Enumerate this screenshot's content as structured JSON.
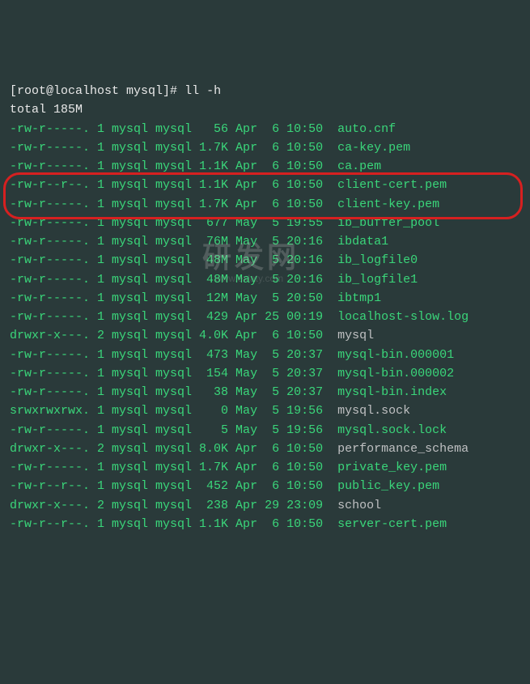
{
  "prompt": {
    "user_host": "root@localhost",
    "cwd": "mysql",
    "symbol": "#",
    "command": "ll -h"
  },
  "total_line": "total 185M",
  "rows": [
    {
      "perm": "-rw-r-----.",
      "n": "1",
      "owner": "mysql",
      "group": "mysql",
      "size": "56",
      "mon": "Apr",
      "day": "6",
      "time": "10:50",
      "name": "auto.cnf",
      "dir": false
    },
    {
      "perm": "-rw-r-----.",
      "n": "1",
      "owner": "mysql",
      "group": "mysql",
      "size": "1.7K",
      "mon": "Apr",
      "day": "6",
      "time": "10:50",
      "name": "ca-key.pem",
      "dir": false
    },
    {
      "perm": "-rw-r-----.",
      "n": "1",
      "owner": "mysql",
      "group": "mysql",
      "size": "1.1K",
      "mon": "Apr",
      "day": "6",
      "time": "10:50",
      "name": "ca.pem",
      "dir": false
    },
    {
      "perm": "-rw-r--r--.",
      "n": "1",
      "owner": "mysql",
      "group": "mysql",
      "size": "1.1K",
      "mon": "Apr",
      "day": "6",
      "time": "10:50",
      "name": "client-cert.pem",
      "dir": false
    },
    {
      "perm": "-rw-r-----.",
      "n": "1",
      "owner": "mysql",
      "group": "mysql",
      "size": "1.7K",
      "mon": "Apr",
      "day": "6",
      "time": "10:50",
      "name": "client-key.pem",
      "dir": false
    },
    {
      "perm": "-rw-r-----.",
      "n": "1",
      "owner": "mysql",
      "group": "mysql",
      "size": "677",
      "mon": "May",
      "day": "5",
      "time": "19:55",
      "name": "ib_buffer_pool",
      "dir": false
    },
    {
      "perm": "-rw-r-----.",
      "n": "1",
      "owner": "mysql",
      "group": "mysql",
      "size": "76M",
      "mon": "May",
      "day": "5",
      "time": "20:16",
      "name": "ibdata1",
      "dir": false
    },
    {
      "perm": "-rw-r-----.",
      "n": "1",
      "owner": "mysql",
      "group": "mysql",
      "size": "48M",
      "mon": "May",
      "day": "5",
      "time": "20:16",
      "name": "ib_logfile0",
      "dir": false
    },
    {
      "perm": "-rw-r-----.",
      "n": "1",
      "owner": "mysql",
      "group": "mysql",
      "size": "48M",
      "mon": "May",
      "day": "5",
      "time": "20:16",
      "name": "ib_logfile1",
      "dir": false
    },
    {
      "perm": "-rw-r-----.",
      "n": "1",
      "owner": "mysql",
      "group": "mysql",
      "size": "12M",
      "mon": "May",
      "day": "5",
      "time": "20:50",
      "name": "ibtmp1",
      "dir": false
    },
    {
      "perm": "-rw-r-----.",
      "n": "1",
      "owner": "mysql",
      "group": "mysql",
      "size": "429",
      "mon": "Apr",
      "day": "25",
      "time": "00:19",
      "name": "localhost-slow.log",
      "dir": false
    },
    {
      "perm": "drwxr-x---.",
      "n": "2",
      "owner": "mysql",
      "group": "mysql",
      "size": "4.0K",
      "mon": "Apr",
      "day": "6",
      "time": "10:50",
      "name": "mysql",
      "dir": true
    },
    {
      "perm": "-rw-r-----.",
      "n": "1",
      "owner": "mysql",
      "group": "mysql",
      "size": "473",
      "mon": "May",
      "day": "5",
      "time": "20:37",
      "name": "mysql-bin.000001",
      "dir": false
    },
    {
      "perm": "-rw-r-----.",
      "n": "1",
      "owner": "mysql",
      "group": "mysql",
      "size": "154",
      "mon": "May",
      "day": "5",
      "time": "20:37",
      "name": "mysql-bin.000002",
      "dir": false
    },
    {
      "perm": "-rw-r-----.",
      "n": "1",
      "owner": "mysql",
      "group": "mysql",
      "size": "38",
      "mon": "May",
      "day": "5",
      "time": "20:37",
      "name": "mysql-bin.index",
      "dir": false
    },
    {
      "perm": "srwxrwxrwx.",
      "n": "1",
      "owner": "mysql",
      "group": "mysql",
      "size": "0",
      "mon": "May",
      "day": "5",
      "time": "19:56",
      "name": "mysql.sock",
      "dir": true
    },
    {
      "perm": "-rw-r-----.",
      "n": "1",
      "owner": "mysql",
      "group": "mysql",
      "size": "5",
      "mon": "May",
      "day": "5",
      "time": "19:56",
      "name": "mysql.sock.lock",
      "dir": false
    },
    {
      "perm": "drwxr-x---.",
      "n": "2",
      "owner": "mysql",
      "group": "mysql",
      "size": "8.0K",
      "mon": "Apr",
      "day": "6",
      "time": "10:50",
      "name": "performance_schema",
      "dir": true
    },
    {
      "perm": "-rw-r-----.",
      "n": "1",
      "owner": "mysql",
      "group": "mysql",
      "size": "1.7K",
      "mon": "Apr",
      "day": "6",
      "time": "10:50",
      "name": "private_key.pem",
      "dir": false
    },
    {
      "perm": "-rw-r--r--.",
      "n": "1",
      "owner": "mysql",
      "group": "mysql",
      "size": "452",
      "mon": "Apr",
      "day": "6",
      "time": "10:50",
      "name": "public_key.pem",
      "dir": false
    },
    {
      "perm": "drwxr-x---.",
      "n": "2",
      "owner": "mysql",
      "group": "mysql",
      "size": "238",
      "mon": "Apr",
      "day": "29",
      "time": "23:09",
      "name": "school",
      "dir": true
    },
    {
      "perm": "-rw-r--r--.",
      "n": "1",
      "owner": "mysql",
      "group": "mysql",
      "size": "1.1K",
      "mon": "Apr",
      "day": "6",
      "time": "10:50",
      "name": "server-cert.pem",
      "dir": false
    }
  ],
  "highlight_indices": [
    7,
    8
  ],
  "watermark_main": "研发网",
  "watermark_sub": "www.exlaty.com"
}
